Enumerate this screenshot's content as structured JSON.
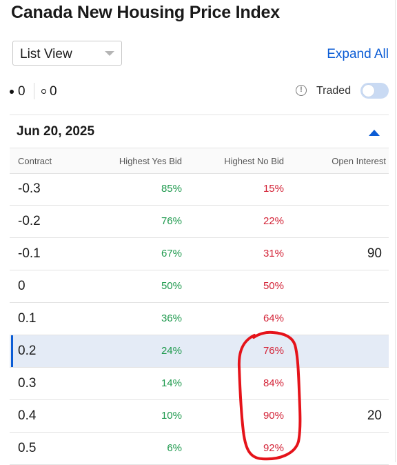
{
  "page": {
    "title": "Canada New Housing Price Index"
  },
  "controls": {
    "view_select_value": "List View",
    "expand_all_label": "Expand All",
    "legend_filled_count": "0",
    "legend_hollow_count": "0",
    "traded_label": "Traded",
    "traded_toggle_on": false
  },
  "section": {
    "date": "Jun 20, 2025"
  },
  "table": {
    "headers": {
      "contract": "Contract",
      "yes_bid": "Highest Yes Bid",
      "no_bid": "Highest No Bid",
      "open_interest": "Open Interest"
    },
    "rows": [
      {
        "contract": "-0.3",
        "yes": "85%",
        "no": "15%",
        "oi": ""
      },
      {
        "contract": "-0.2",
        "yes": "76%",
        "no": "22%",
        "oi": ""
      },
      {
        "contract": "-0.1",
        "yes": "67%",
        "no": "31%",
        "oi": "90"
      },
      {
        "contract": "0",
        "yes": "50%",
        "no": "50%",
        "oi": ""
      },
      {
        "contract": "0.1",
        "yes": "36%",
        "no": "64%",
        "oi": ""
      },
      {
        "contract": "0.2",
        "yes": "24%",
        "no": "76%",
        "oi": ""
      },
      {
        "contract": "0.3",
        "yes": "14%",
        "no": "84%",
        "oi": ""
      },
      {
        "contract": "0.4",
        "yes": "10%",
        "no": "90%",
        "oi": "20"
      },
      {
        "contract": "0.5",
        "yes": "6%",
        "no": "92%",
        "oi": ""
      }
    ],
    "selected_row_index": 5
  },
  "colors": {
    "accent": "#0b5cd5",
    "yes_green": "#1f9a4e",
    "no_red": "#d32236",
    "selected_row_bg": "#e4ebf6",
    "annotation_red": "#e5131a"
  },
  "icons": {
    "info": "info-circle-icon",
    "dropdown": "chevron-down-icon",
    "collapse": "caret-up-icon"
  }
}
